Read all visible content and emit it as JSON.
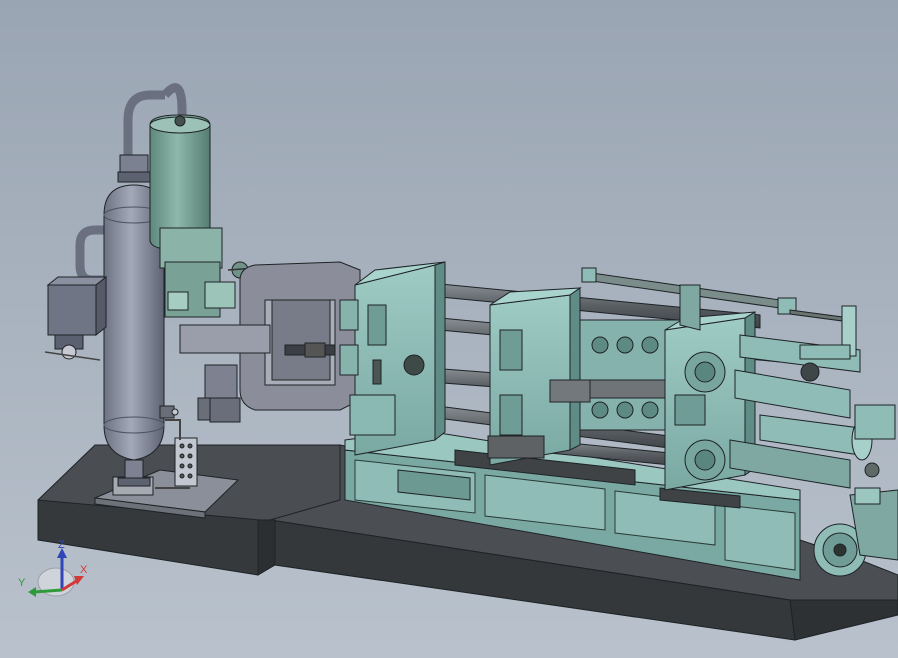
{
  "viewport": {
    "background_top": "#9aa5b3",
    "background_bottom": "#b9c2cc"
  },
  "model": {
    "colors": {
      "machine_teal": "#8fbcb6",
      "machine_teal_dark": "#5f8c87",
      "tank_gray": "#8d93a3",
      "tank_dark": "#666c7c",
      "base_dark": "#3b3f43",
      "base_top": "#4a4e52",
      "rod_gray": "#6f7479",
      "cylinder_green": "#7fa89c",
      "edge": "#1e2326"
    }
  },
  "triad": {
    "x_label": "X",
    "y_label": "Y",
    "z_label": "Z",
    "x_color": "#d23a3a",
    "y_color": "#2e9b3a",
    "z_color": "#2f45b8"
  }
}
